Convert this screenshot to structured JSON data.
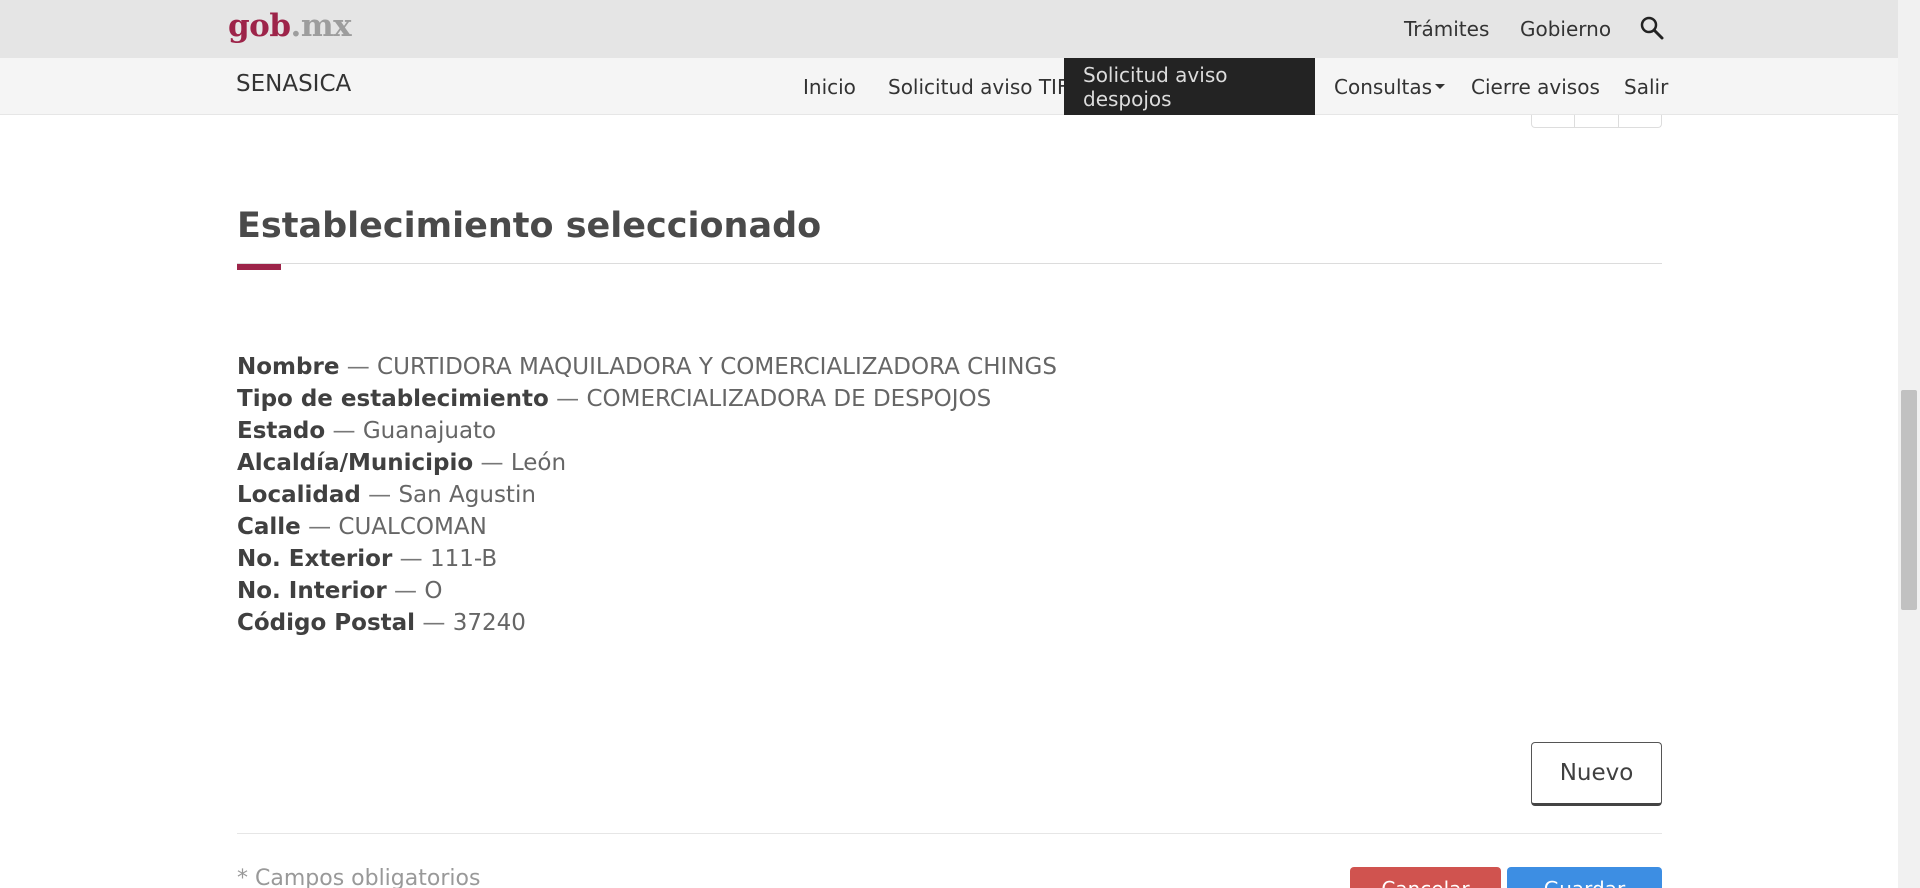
{
  "header": {
    "logo_gob": "gob",
    "logo_dot": ".",
    "logo_mx": "mx",
    "links": [
      "Trámites",
      "Gobierno"
    ],
    "search_icon": "search-icon"
  },
  "subnav": {
    "brand": "SENASICA",
    "items": [
      {
        "label": "Inicio",
        "active": false
      },
      {
        "label": "Solicitud aviso TIF",
        "active": false
      },
      {
        "label": "Solicitud aviso despojos",
        "active": true
      },
      {
        "label": "Consultas",
        "active": false,
        "dropdown": true
      },
      {
        "label": "Cierre avisos",
        "active": false
      },
      {
        "label": "Salir",
        "active": false
      }
    ]
  },
  "section": {
    "title": "Establecimiento seleccionado",
    "separator": "—",
    "fields": [
      {
        "label": "Nombre",
        "value": "CURTIDORA MAQUILADORA Y COMERCIALIZADORA CHINGS"
      },
      {
        "label": "Tipo de establecimiento",
        "value": "COMERCIALIZADORA DE DESPOJOS"
      },
      {
        "label": "Estado",
        "value": "Guanajuato"
      },
      {
        "label": "Alcaldía/Municipio",
        "value": "León"
      },
      {
        "label": "Localidad",
        "value": "San Agustin"
      },
      {
        "label": "Calle",
        "value": "CUALCOMAN"
      },
      {
        "label": "No. Exterior",
        "value": "111-B"
      },
      {
        "label": "No. Interior",
        "value": "O"
      },
      {
        "label": "Código Postal",
        "value": "37240"
      }
    ]
  },
  "actions": {
    "nuevo_label": "Nuevo",
    "required_note": "* Campos obligatorios",
    "red_button_label": "Cancelar",
    "blue_button_label": "Guardar"
  },
  "colors": {
    "brand": "#9d2449",
    "active_nav_bg": "#232323",
    "danger": "#d0534f",
    "primary": "#3d8ee3"
  }
}
